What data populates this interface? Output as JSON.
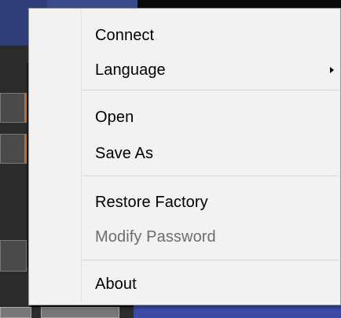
{
  "context_menu": {
    "items": [
      {
        "label": "Connect",
        "enabled": true
      },
      {
        "label": "Language",
        "enabled": true,
        "has_submenu": true
      },
      {
        "label": "Open",
        "enabled": true
      },
      {
        "label": "Save As",
        "enabled": true
      },
      {
        "label": "Restore Factory",
        "enabled": true
      },
      {
        "label": "Modify Password",
        "enabled": false
      },
      {
        "label": "About",
        "enabled": true
      }
    ]
  }
}
